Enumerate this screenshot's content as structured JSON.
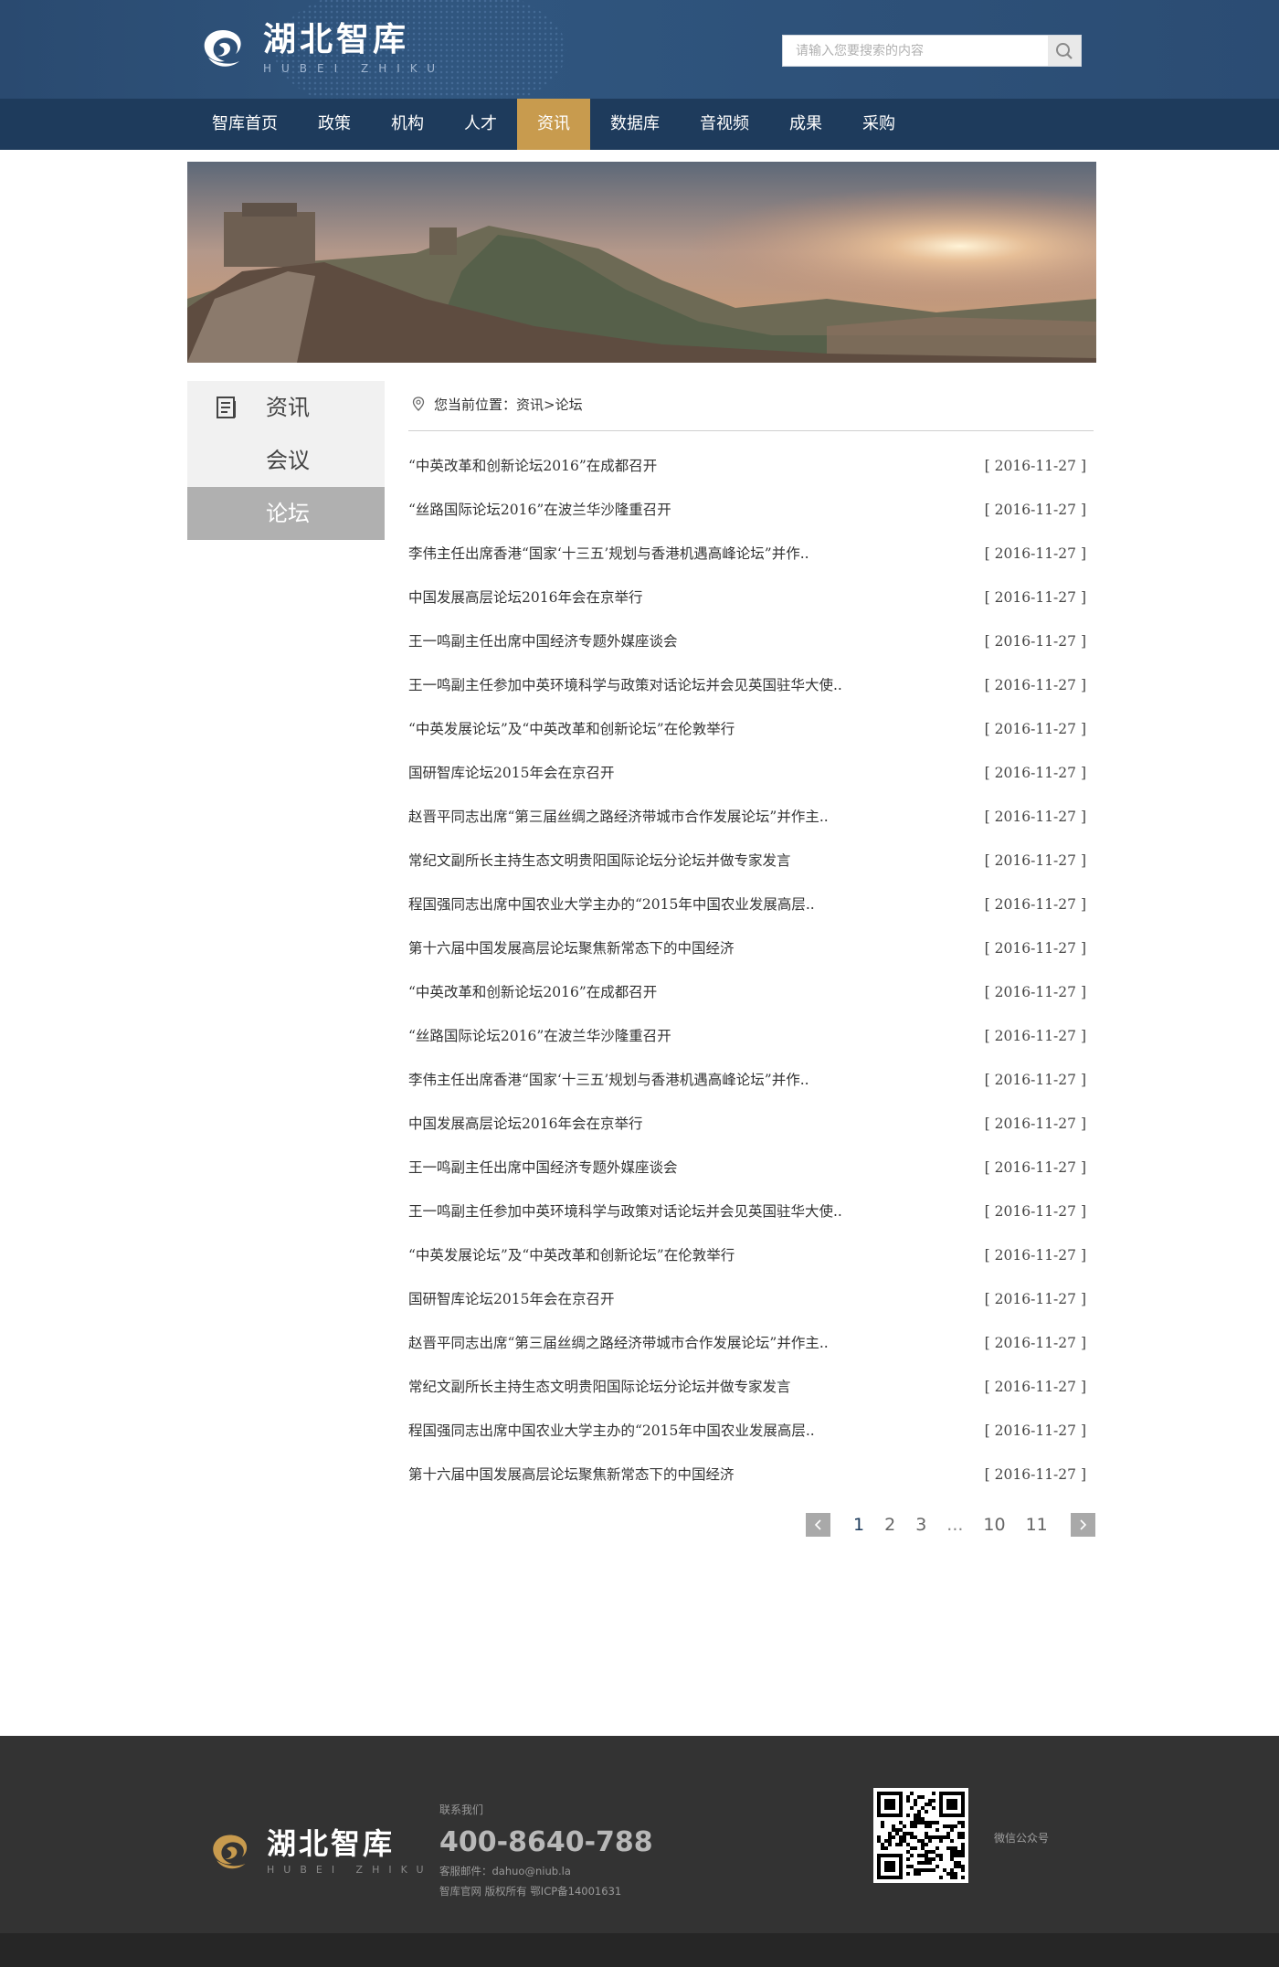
{
  "header": {
    "logo_cn": "湖北智库",
    "logo_en": "HUBEI ZHIKU",
    "search_placeholder": "请输入您要搜索的内容"
  },
  "nav": {
    "items": [
      "智库首页",
      "政策",
      "机构",
      "人才",
      "资讯",
      "数据库",
      "音视频",
      "成果",
      "采购"
    ],
    "active_index": 4
  },
  "sidebar": {
    "items": [
      "资讯",
      "会议",
      "论坛"
    ],
    "active_index": 2
  },
  "breadcrumb": "您当前位置：资讯>论坛",
  "articles": [
    {
      "title": "“中英改革和创新论坛2016”在成都召开",
      "date": "[ 2016-11-27 ]"
    },
    {
      "title": "“丝路国际论坛2016”在波兰华沙隆重召开",
      "date": "[ 2016-11-27 ]"
    },
    {
      "title": "李伟主任出席香港“国家‘十三五’规划与香港机遇高峰论坛”并作..",
      "date": "[ 2016-11-27 ]"
    },
    {
      "title": "中国发展高层论坛2016年会在京举行",
      "date": "[ 2016-11-27 ]"
    },
    {
      "title": "王一鸣副主任出席中国经济专题外媒座谈会",
      "date": "[ 2016-11-27 ]"
    },
    {
      "title": "王一鸣副主任参加中英环境科学与政策对话论坛并会见英国驻华大使..",
      "date": "[ 2016-11-27 ]"
    },
    {
      "title": "“中英发展论坛”及“中英改革和创新论坛”在伦敦举行",
      "date": "[ 2016-11-27 ]"
    },
    {
      "title": "国研智库论坛2015年会在京召开",
      "date": "[ 2016-11-27 ]"
    },
    {
      "title": "赵晋平同志出席“第三届丝绸之路经济带城市合作发展论坛”并作主..",
      "date": "[ 2016-11-27 ]"
    },
    {
      "title": "常纪文副所长主持生态文明贵阳国际论坛分论坛并做专家发言",
      "date": "[ 2016-11-27 ]"
    },
    {
      "title": "程国强同志出席中国农业大学主办的“2015年中国农业发展高层..",
      "date": "[ 2016-11-27 ]"
    },
    {
      "title": "第十六届中国发展高层论坛聚焦新常态下的中国经济",
      "date": "[ 2016-11-27 ]"
    },
    {
      "title": "“中英改革和创新论坛2016”在成都召开",
      "date": "[ 2016-11-27 ]"
    },
    {
      "title": "“丝路国际论坛2016”在波兰华沙隆重召开",
      "date": "[ 2016-11-27 ]"
    },
    {
      "title": "李伟主任出席香港“国家‘十三五’规划与香港机遇高峰论坛”并作..",
      "date": "[ 2016-11-27 ]"
    },
    {
      "title": "中国发展高层论坛2016年会在京举行",
      "date": "[ 2016-11-27 ]"
    },
    {
      "title": "王一鸣副主任出席中国经济专题外媒座谈会",
      "date": "[ 2016-11-27 ]"
    },
    {
      "title": "王一鸣副主任参加中英环境科学与政策对话论坛并会见英国驻华大使..",
      "date": "[ 2016-11-27 ]"
    },
    {
      "title": "“中英发展论坛”及“中英改革和创新论坛”在伦敦举行",
      "date": "[ 2016-11-27 ]"
    },
    {
      "title": "国研智库论坛2015年会在京召开",
      "date": "[ 2016-11-27 ]"
    },
    {
      "title": "赵晋平同志出席“第三届丝绸之路经济带城市合作发展论坛”并作主..",
      "date": "[ 2016-11-27 ]"
    },
    {
      "title": "常纪文副所长主持生态文明贵阳国际论坛分论坛并做专家发言",
      "date": "[ 2016-11-27 ]"
    },
    {
      "title": "程国强同志出席中国农业大学主办的“2015年中国农业发展高层..",
      "date": "[ 2016-11-27 ]"
    },
    {
      "title": "第十六届中国发展高层论坛聚焦新常态下的中国经济",
      "date": "[ 2016-11-27 ]"
    }
  ],
  "pagination": {
    "pages": [
      "1",
      "2",
      "3",
      "...",
      "10",
      "11"
    ],
    "current": "1"
  },
  "footer": {
    "logo_cn": "湖北智库",
    "logo_en": "HUBEI ZHIKU",
    "contact_label": "联系我们",
    "phone": "400-8640-788",
    "email": "客服邮件：dahuo@niub.la",
    "copyright": "智库官网 版权所有 鄂ICP备14001631",
    "qr_label": "微信公众号"
  },
  "colors": {
    "header_bg": "#2b4c73",
    "nav_bg": "#1e3b5c",
    "nav_active": "#c89b4e",
    "sidebar_active": "#b0b0b0",
    "footer_bg": "#333333"
  },
  "icons": [
    "logo-mark",
    "search-icon",
    "document-icon",
    "location-pin-icon",
    "arrow-left-icon",
    "arrow-right-icon",
    "qr-code"
  ]
}
